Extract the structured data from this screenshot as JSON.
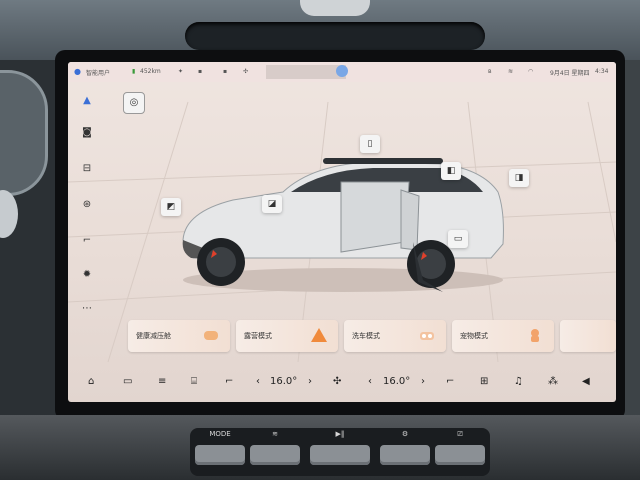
{
  "status_bar": {
    "left_text": "智能用户",
    "range": "452km",
    "date": "9月4日 星期四",
    "time": "4:34"
  },
  "modes": [
    {
      "label": "健康减压舱",
      "icon": "cushion-icon"
    },
    {
      "label": "露营模式",
      "icon": "tent-icon"
    },
    {
      "label": "洗车模式",
      "icon": "car-wash-icon"
    },
    {
      "label": "宠物模式",
      "icon": "pet-icon"
    }
  ],
  "climate": {
    "left_temp": "16.0°",
    "right_temp": "16.0°"
  },
  "console_buttons": {
    "mode_label": "MODE",
    "colors": {
      "console": "#1a1d20",
      "key": "#8b9095"
    }
  },
  "colors": {
    "screen_bg": "#efe5e0",
    "car_body": "#e6e7e8",
    "accent": "#3b6fd6",
    "brake": "#e0402b"
  }
}
